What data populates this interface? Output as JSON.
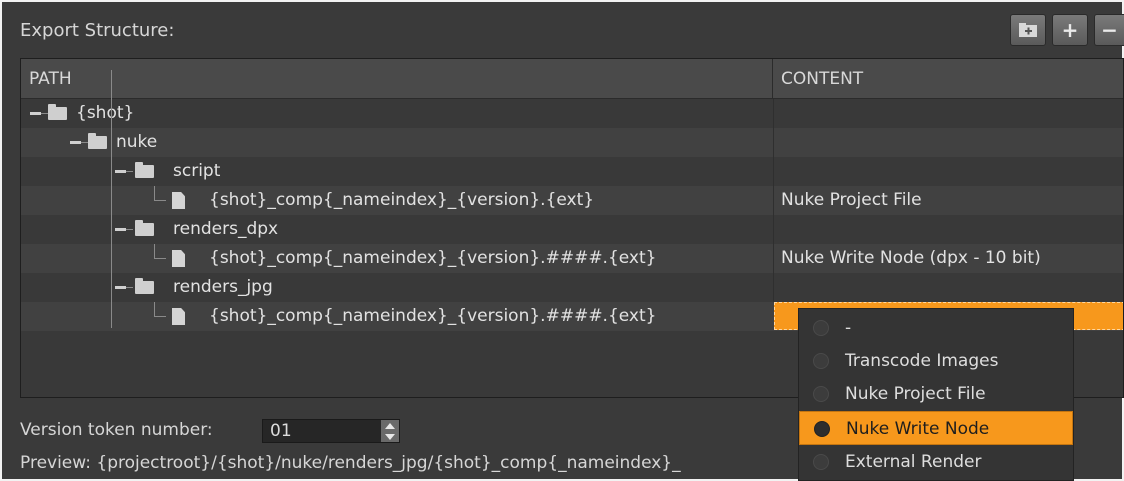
{
  "panel": {
    "title": "Export Structure:"
  },
  "toolbar": {
    "buttons": [
      {
        "name": "add-folder-button",
        "icon": "folder-add-icon"
      },
      {
        "name": "add-button",
        "icon": "plus-icon",
        "glyph": "+"
      },
      {
        "name": "remove-button",
        "icon": "minus-icon",
        "glyph": "−"
      }
    ]
  },
  "tree": {
    "columns": {
      "path": "PATH",
      "content": "CONTENT"
    },
    "rows": [
      {
        "name": "{shot}",
        "type": "folder",
        "content": ""
      },
      {
        "name": "nuke",
        "type": "folder",
        "content": ""
      },
      {
        "name": "script",
        "type": "folder",
        "content": ""
      },
      {
        "name": "{shot}_comp{_nameindex}_{version}.{ext}",
        "type": "file",
        "content": "Nuke Project File"
      },
      {
        "name": "renders_dpx",
        "type": "folder",
        "content": ""
      },
      {
        "name": "{shot}_comp{_nameindex}_{version}.####.{ext}",
        "type": "file",
        "content": "Nuke Write Node (dpx - 10 bit)"
      },
      {
        "name": "renders_jpg",
        "type": "folder",
        "content": ""
      },
      {
        "name": "{shot}_comp{_nameindex}_{version}.####.{ext}",
        "type": "file",
        "content": ""
      }
    ]
  },
  "version": {
    "label": "Version token number:",
    "value": "01"
  },
  "preview": {
    "text": "Preview: {projectroot}/{shot}/nuke/renders_jpg/{shot}_comp{_nameindex}_"
  },
  "content_menu": {
    "items": [
      {
        "label": "-",
        "selected": false
      },
      {
        "label": "Transcode Images",
        "selected": false
      },
      {
        "label": "Nuke Project File",
        "selected": false
      },
      {
        "label": "Nuke Write Node",
        "selected": true
      },
      {
        "label": "External Render",
        "selected": false
      }
    ]
  },
  "colors": {
    "accent": "#f7981c",
    "background": "#3a3a3a"
  }
}
